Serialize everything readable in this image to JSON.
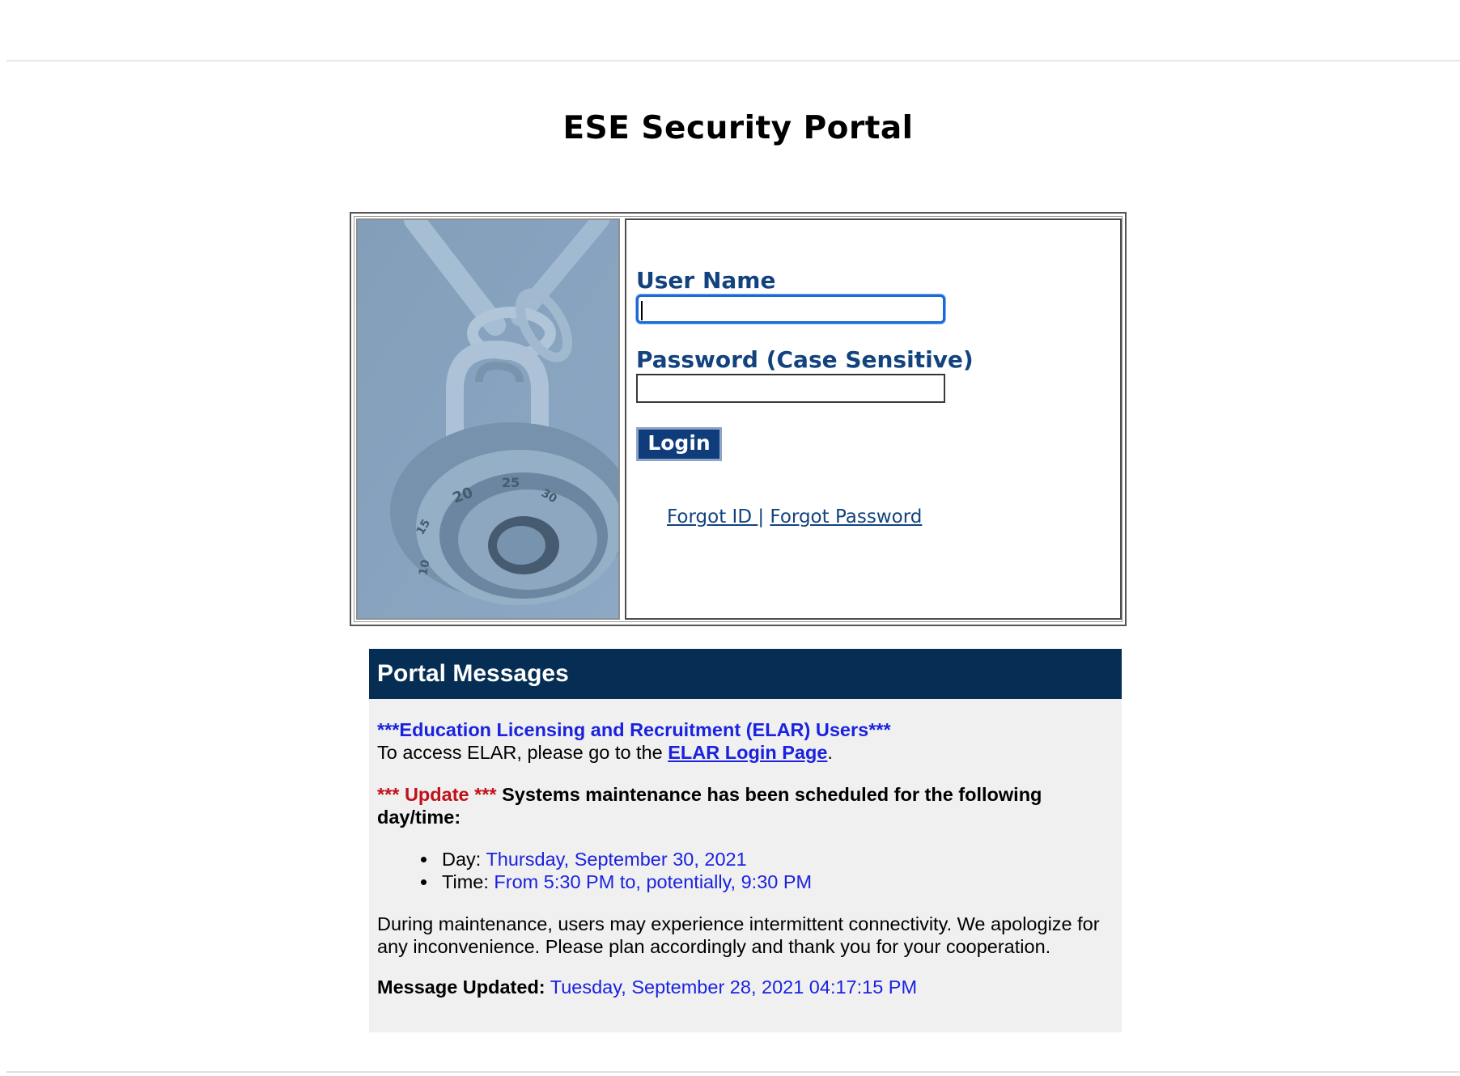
{
  "page": {
    "title": "ESE Security Portal"
  },
  "login": {
    "image_alt": "padlock-chain-image",
    "username_label": "User Name",
    "username_value": "",
    "password_label": "Password (Case Sensitive)",
    "password_value": "",
    "login_button": "Login",
    "forgot_id": "Forgot ID ",
    "separator": "|",
    "forgot_password": "Forgot Password",
    "colors": {
      "label": "#12437e",
      "button_bg": "#0f3d7c",
      "focus_border": "#1a6ad6"
    }
  },
  "messages": {
    "header": "Portal Messages",
    "elar_heading": "***Education Licensing and Recruitment (ELAR) Users***",
    "elar_text_before": "To access ELAR, please go to the ",
    "elar_link": "ELAR Login Page",
    "elar_text_after": ".",
    "update_tag": "*** Update ***",
    "update_text": " Systems maintenance has been scheduled for the following day/time:",
    "day_label": "Day: ",
    "day_value": "Thursday, September 30, 2021",
    "time_label": "Time: ",
    "time_value": "From 5:30 PM to, potentially, 9:30 PM",
    "maintenance_text": "During maintenance, users may experience intermittent connectivity. We apologize for any inconvenience. Please plan accordingly and thank you for your cooperation.",
    "updated_label": "Message Updated:",
    "updated_value": " Tuesday, September 28, 2021 04:17:15 PM",
    "colors": {
      "header_bg": "#062e55",
      "panel_bg": "#f0f0f0",
      "highlight_blue": "#1a22e0",
      "highlight_red": "#c0111b"
    }
  }
}
